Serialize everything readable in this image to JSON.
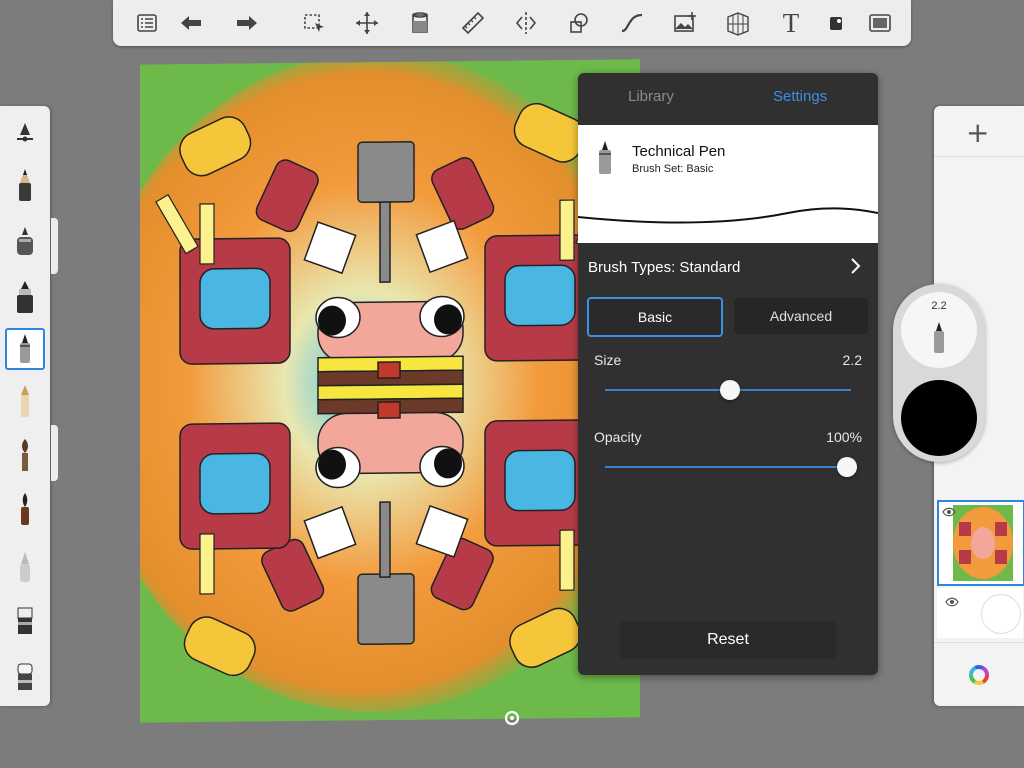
{
  "toolbar": {
    "items": [
      {
        "name": "menu-icon"
      },
      {
        "name": "undo-icon"
      },
      {
        "name": "redo-icon"
      },
      {
        "name": "select-icon"
      },
      {
        "name": "transform-icon"
      },
      {
        "name": "fill-icon"
      },
      {
        "name": "ruler-icon"
      },
      {
        "name": "symmetry-icon"
      },
      {
        "name": "shapes-icon"
      },
      {
        "name": "curve-icon"
      },
      {
        "name": "image-icon"
      },
      {
        "name": "perspective-icon"
      },
      {
        "name": "text-icon",
        "glyph": "T"
      },
      {
        "name": "color-sampler-icon"
      },
      {
        "name": "fullscreen-icon"
      }
    ]
  },
  "brush_settings": {
    "tabs": {
      "library": "Library",
      "settings": "Settings"
    },
    "brush_name": "Technical Pen",
    "brush_set": "Brush Set: Basic",
    "brush_types_label": "Brush Types: Standard",
    "mode_basic": "Basic",
    "mode_advanced": "Advanced",
    "size_label": "Size",
    "size_value": "2.2",
    "size_fraction": 0.51,
    "opacity_label": "Opacity",
    "opacity_value": "100%",
    "opacity_fraction": 1.0,
    "reset_label": "Reset"
  },
  "puck": {
    "size_value": "2.2",
    "color": "#000000"
  },
  "colors": {
    "accent": "#3b8fe5",
    "panel": "#303030",
    "canvas_bg": "#6db94a",
    "current_color": "#000000"
  }
}
